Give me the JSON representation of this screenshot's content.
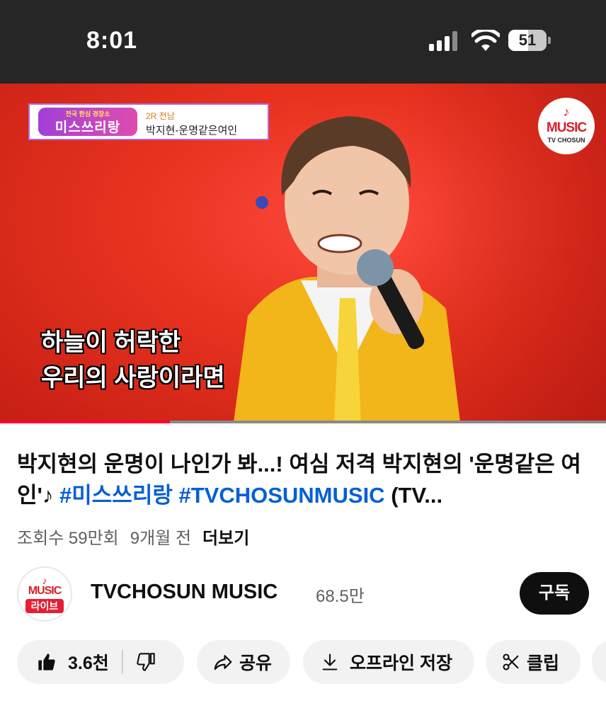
{
  "status_bar": {
    "time": "8:01",
    "battery": "51",
    "battery_level": 0.51
  },
  "video": {
    "program_logo": "미스쓰리랑",
    "program_logo_sub": "전국 한심 경창소",
    "program_round": "2R 전남",
    "program_song": "박지현-운명같은여인",
    "channel_badge": {
      "main": "MUSIC",
      "sub": "TV CHOSUN"
    },
    "subtitle_lines": [
      "하늘이 허락한",
      "우리의 사랑이라면"
    ],
    "progress": 0.28
  },
  "title": {
    "text_part": "박지현의 운명이 나인가 봐...! 여심 저격 박지현의 '운명같은 여인'♪ ",
    "hashtag_1": "#미스쓰리랑",
    "hashtag_2": "#TVCHOSUNMUSIC",
    "tail": " (TV..."
  },
  "meta": {
    "views": "조회수 59만회",
    "age": "9개월 전",
    "more": "더보기"
  },
  "channel": {
    "name": "TVCHOSUN MUSIC",
    "subscribers": "68.5만",
    "subscribe_label": "구독",
    "avatar_main": "MUSIC",
    "avatar_live": "라이브"
  },
  "actions": {
    "like_count": "3.6천",
    "share_label": "공유",
    "save_label": "오프라인 저장",
    "clip_label": "클립"
  },
  "colors": {
    "accent_red": "#ff0033",
    "hashtag_blue": "#065fd4",
    "status_bar": "#262626"
  }
}
